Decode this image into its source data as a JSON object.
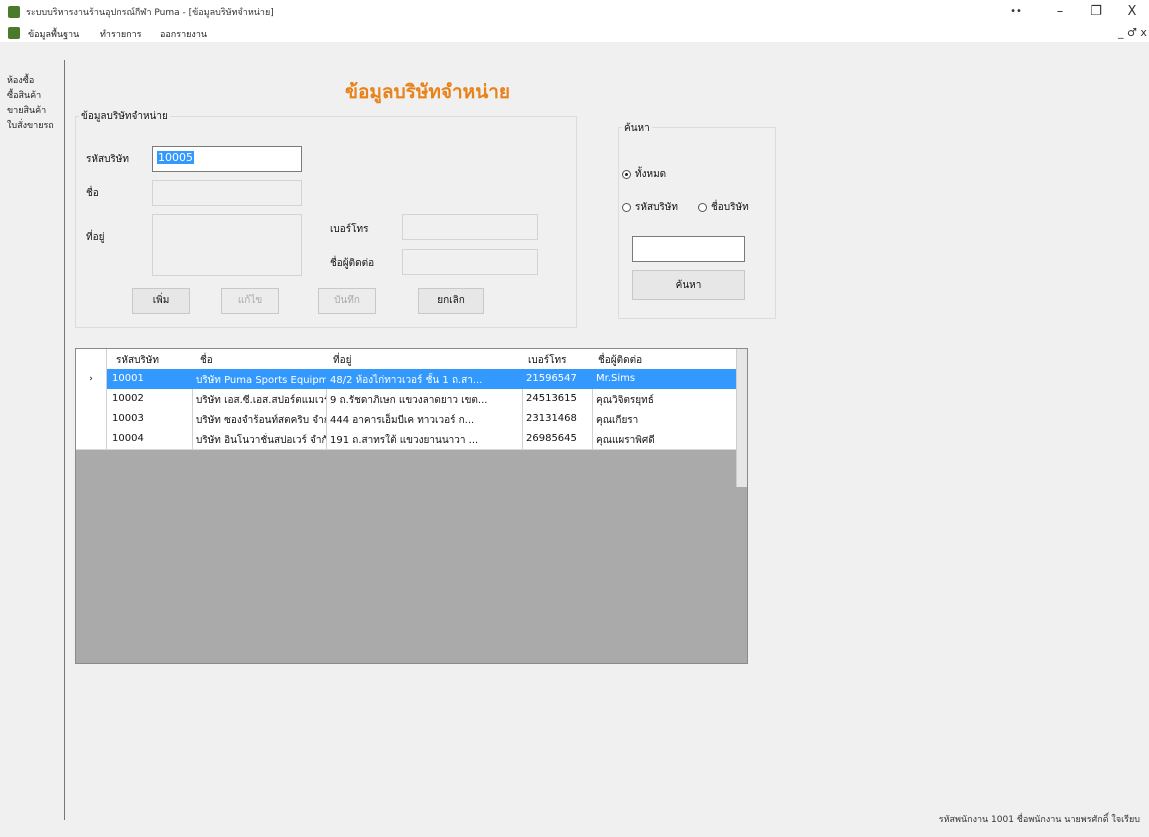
{
  "window": {
    "title": "ระบบบริหารงานร้านอุปกรณ์กีฬา Puma - [ข้อมูลบริษัทจำหน่าย]",
    "controls": {
      "extra": "••",
      "minimize": "–",
      "restore": "❐",
      "close": "X"
    }
  },
  "menu": {
    "items": [
      "ข้อมูลพื้นฐาน",
      "ทำรายการ",
      "ออกรายงาน"
    ],
    "mdi_controls": "_ ♂ x"
  },
  "leftnav": {
    "items": [
      "ห้องซื้อ",
      "ซื้อสินค้า",
      "ขายสินค้า",
      "ใบสั่งขายรถ"
    ]
  },
  "heading": "ข้อมูลบริษัทจำหน่าย",
  "form": {
    "group_title": "ข้อมูลบริษัทจำหน่าย",
    "code_label": "รหัสบริษัท",
    "code_value": "10005",
    "name_label": "ชื่อ",
    "address_label": "ที่อยู่",
    "phone_label": "เบอร์โทร",
    "contact_label": "ชื่อผู้ติดต่อ",
    "buttons": {
      "add": "เพิ่ม",
      "edit": "แก้ไข",
      "save": "บันทึก",
      "cancel": "ยกเลิก"
    }
  },
  "search": {
    "group_title": "ค้นหา",
    "options": {
      "all": "ทั้งหมด",
      "by_code": "รหัสบริษัท",
      "by_name": "ชื่อบริษัท"
    },
    "selected": "all",
    "query": "",
    "button": "ค้นหา"
  },
  "grid": {
    "columns": [
      "รหัสบริษัท",
      "ชื่อ",
      "ที่อยู่",
      "เบอร์โทร",
      "ชื่อผู้ติดต่อ"
    ],
    "rows": [
      {
        "code": "10001",
        "name": "บริษัท Puma Sports Equipment จำกัด",
        "address": "48/2 ห้องไก่ทาวเวอร์ ชั้น 1 ถ.สา...",
        "phone": "21596547",
        "contact": "Mr.Sims",
        "selected": true
      },
      {
        "code": "10002",
        "name": "บริษัท เอส.ซี.เอส.สปอร์ตแมเวร์ จำกัด",
        "address": "9 ถ.รัชดาภิเษก แขวงลาดยาว เขต...",
        "phone": "24513615",
        "contact": "คุณวิจิตรยุทธ์",
        "selected": false
      },
      {
        "code": "10003",
        "name": "บริษัท ซองจำร้อนท์สตคริบ จำกัด",
        "address": "444 อาคารเอ็มบีเค ทาวเวอร์ ก...",
        "phone": "23131468",
        "contact": "คุณเกียรา",
        "selected": false
      },
      {
        "code": "10004",
        "name": "บริษัท อินโนวาชั่นสปอเวร์ จำกัด",
        "address": "191 ถ.สาทรใต้ แขวงยานนาวา ...",
        "phone": "26985645",
        "contact": "คุณแผราพิศดี",
        "selected": false
      }
    ]
  },
  "status": "รหัสพนักงาน 1001  ชื่อพนักงาน นายพรศักดิ์ ใจเรียบ"
}
